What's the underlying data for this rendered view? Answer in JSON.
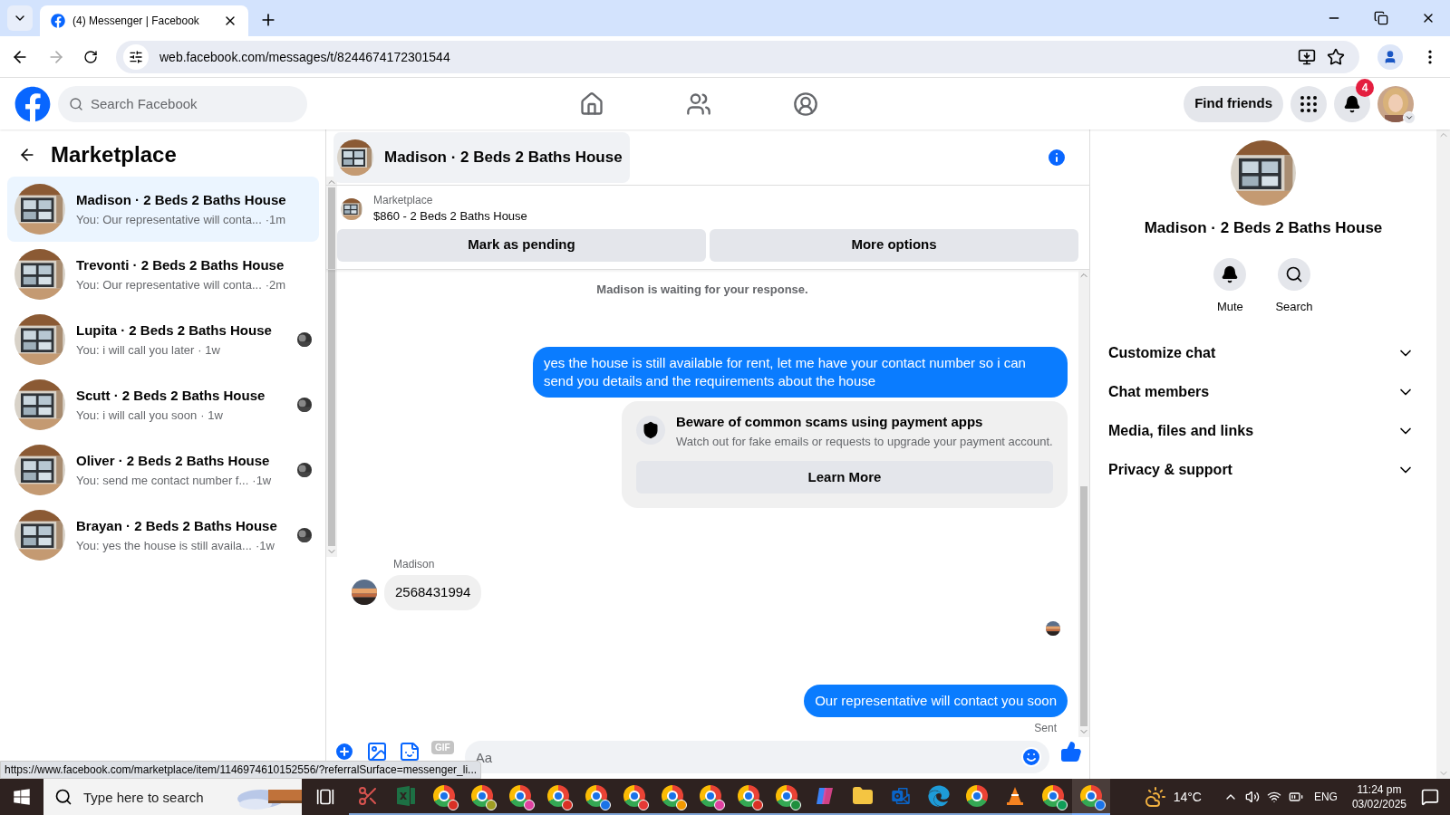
{
  "browser": {
    "tab_title": "(4) Messenger | Facebook",
    "url": "web.facebook.com/messages/t/8244674172301544",
    "status_url": "https://www.facebook.com/marketplace/item/1146974610152556/?referralSurface=messenger_li..."
  },
  "header": {
    "search_placeholder": "Search Facebook",
    "find_friends": "Find friends",
    "notification_count": "4"
  },
  "sidebar": {
    "title": "Marketplace",
    "conversations": [
      {
        "name": "Madison · 2 Beds 2 Baths House",
        "preview": "You: Our representative will conta...",
        "time": "·1m",
        "selected": true,
        "seen": false
      },
      {
        "name": "Trevonti · 2 Beds 2 Baths House",
        "preview": "You: Our representative will conta...",
        "time": "·2m",
        "selected": false,
        "seen": false
      },
      {
        "name": "Lupita · 2 Beds 2 Baths House",
        "preview": "You: i will call you later",
        "time": "· 1w",
        "selected": false,
        "seen": true
      },
      {
        "name": "Scutt · 2 Beds 2 Baths House",
        "preview": "You: i will call you soon",
        "time": "· 1w",
        "selected": false,
        "seen": true
      },
      {
        "name": "Oliver · 2 Beds 2 Baths House",
        "preview": "You: send me contact number f...",
        "time": "·1w",
        "selected": false,
        "seen": true
      },
      {
        "name": "Brayan · 2 Beds 2 Baths House",
        "preview": "You: yes the house is still availa...",
        "time": "·1w",
        "selected": false,
        "seen": true
      }
    ]
  },
  "chat": {
    "title": "Madison · 2 Beds 2 Baths House",
    "listing": {
      "source": "Marketplace",
      "item": "$860 - 2 Beds 2 Baths House",
      "buttons": [
        "Mark as pending",
        "More options"
      ]
    },
    "messages": [
      {
        "kind": "status",
        "text": "Madison is waiting for your response."
      },
      {
        "kind": "outgoing",
        "text": "yes the house is still available for rent, let me have your contact number so i can send you details and the requirements about the house"
      },
      {
        "kind": "notice",
        "title": "Beware of common scams using payment apps",
        "text": "Watch out for fake emails or requests to upgrade your payment account.",
        "button": "Learn More"
      },
      {
        "kind": "incoming",
        "sender": "Madison",
        "text": "2568431994"
      },
      {
        "kind": "receipt"
      },
      {
        "kind": "outgoing",
        "text": "Our representative will contact you soon",
        "status": "Sent"
      }
    ],
    "composer": {
      "gif": "GIF",
      "placeholder": "Aa"
    }
  },
  "details": {
    "title": "Madison · 2 Beds 2 Baths House",
    "actions": [
      {
        "kind": "mute",
        "label": "Mute"
      },
      {
        "kind": "search",
        "label": "Search"
      }
    ],
    "sections": [
      {
        "label": "Customize chat",
        "expanded": false
      },
      {
        "label": "Chat members",
        "expanded": false
      },
      {
        "label": "Media, files and links",
        "expanded": false
      },
      {
        "label": "Privacy & support",
        "expanded": false
      }
    ]
  },
  "taskbar": {
    "search_placeholder": "Type here to search",
    "apps": [
      {
        "kind": "snip",
        "selected": false
      },
      {
        "kind": "excel",
        "selected": false
      },
      {
        "kind": "chrome",
        "color": "#d93025",
        "selected": false
      },
      {
        "kind": "chrome",
        "color": "#9e9d24",
        "selected": false
      },
      {
        "kind": "chrome",
        "color": "#e040a0",
        "selected": false
      },
      {
        "kind": "chrome",
        "color": "#d93025",
        "selected": false
      },
      {
        "kind": "chrome",
        "color": "#1a73e8",
        "selected": false
      },
      {
        "kind": "chrome",
        "color": "#e53935",
        "selected": false
      },
      {
        "kind": "chrome",
        "color": "#f29900",
        "selected": false
      },
      {
        "kind": "chrome",
        "color": "#e040a0",
        "selected": false
      },
      {
        "kind": "chrome",
        "color": "#d93025",
        "selected": false
      },
      {
        "kind": "chrome",
        "color": "#1e8e3e",
        "selected": false
      },
      {
        "kind": "copilot",
        "selected": false
      },
      {
        "kind": "explorer",
        "selected": false
      },
      {
        "kind": "outlook",
        "selected": false
      },
      {
        "kind": "edge",
        "selected": false
      },
      {
        "kind": "chrome",
        "selected": false
      },
      {
        "kind": "vlc",
        "selected": false
      },
      {
        "kind": "chrome",
        "color": "#0f9d58",
        "selected": false
      },
      {
        "kind": "chrome",
        "color": "#1a73e8",
        "selected": true
      }
    ],
    "temperature": "14°C",
    "language": "ENG",
    "time": "11:24 pm",
    "date": "03/02/2025"
  }
}
